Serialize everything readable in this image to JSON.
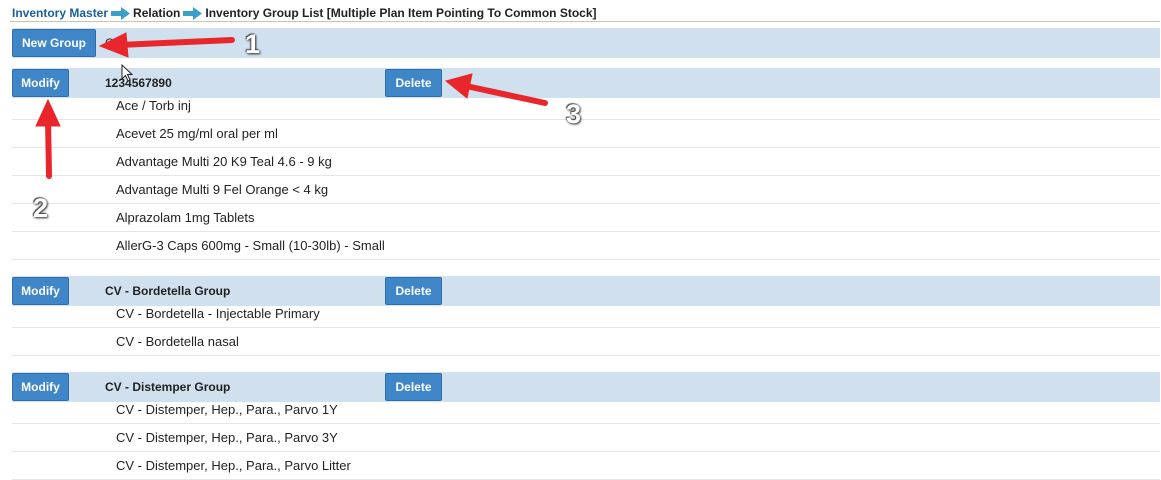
{
  "breadcrumb": {
    "items": [
      "Inventory Master",
      "Relation",
      "Inventory Group List [Multiple Plan Item Pointing To Common Stock]"
    ]
  },
  "toolbar": {
    "new_group_label": "New Group",
    "partial_text": "G"
  },
  "groups": [
    {
      "name": "1234567890",
      "modify_label": "Modify",
      "delete_label": "Delete",
      "items": [
        "Ace / Torb inj",
        "Acevet 25 mg/ml oral per ml",
        "Advantage Multi 20 K9 Teal 4.6 - 9 kg",
        "Advantage Multi 9 Fel Orange < 4 kg",
        "Alprazolam 1mg Tablets",
        "AllerG-3 Caps 600mg - Small (10-30lb) - Small"
      ]
    },
    {
      "name": "CV - Bordetella Group",
      "modify_label": "Modify",
      "delete_label": "Delete",
      "items": [
        "CV - Bordetella - Injectable Primary",
        "CV - Bordetella nasal"
      ]
    },
    {
      "name": "CV - Distemper Group",
      "modify_label": "Modify",
      "delete_label": "Delete",
      "items": [
        "CV - Distemper, Hep., Para., Parvo 1Y",
        "CV - Distemper, Hep., Para., Parvo 3Y",
        "CV - Distemper, Hep., Para., Parvo Litter"
      ]
    }
  ],
  "annotations": {
    "labels": [
      "1",
      "2",
      "3"
    ],
    "arrow_color": "#e8262b"
  },
  "colors": {
    "bar_bg": "#d0e0ee",
    "button_bg": "#3f86c9",
    "breadcrumb_link": "#1a5f99"
  }
}
